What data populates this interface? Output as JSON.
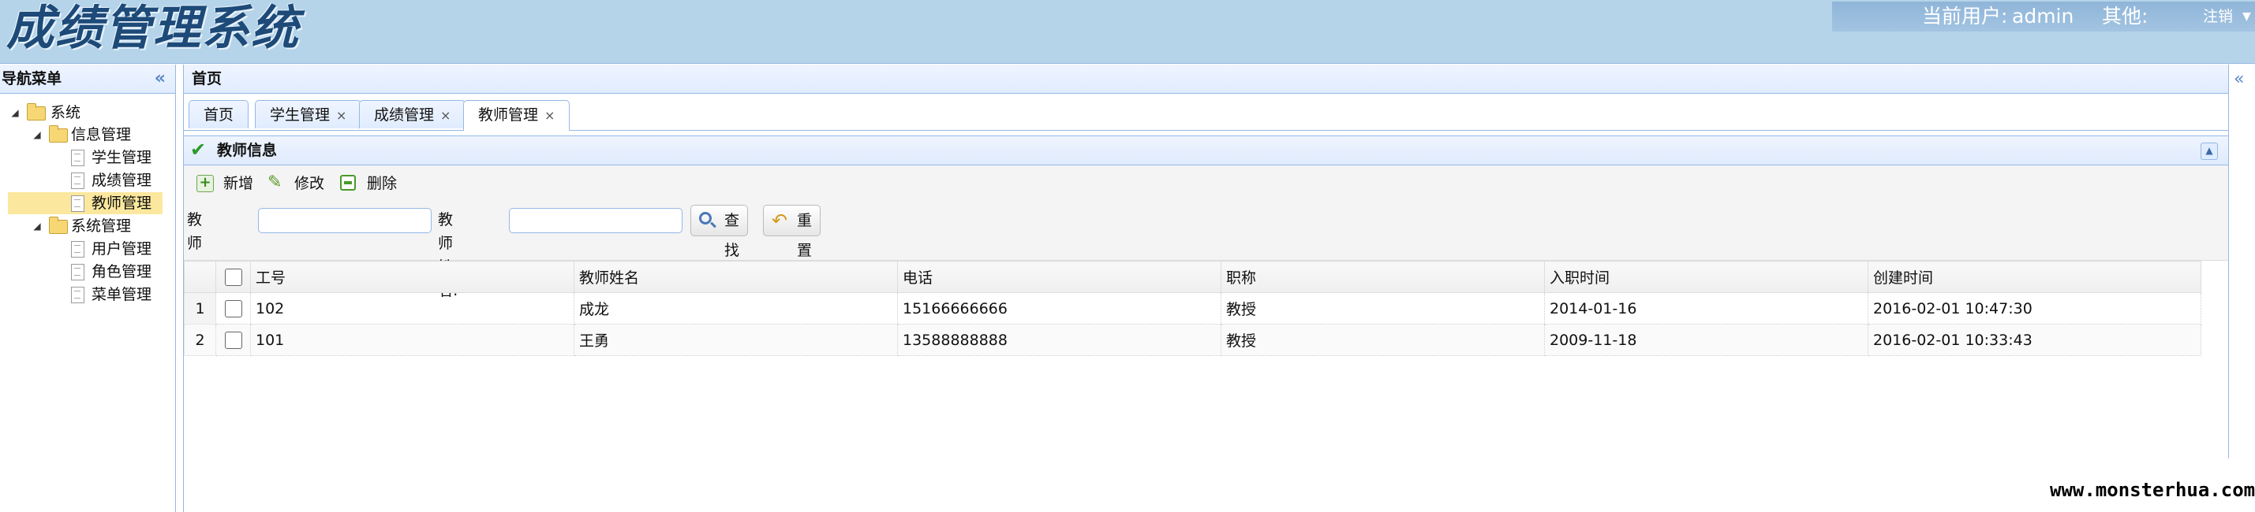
{
  "header": {
    "app_title": "成绩管理系统",
    "current_user_label": "当前用户:",
    "username": "admin",
    "other_label": "其他:",
    "logout_label": "注销"
  },
  "sidebar": {
    "title": "导航菜单",
    "tree": [
      {
        "label": "系统",
        "type": "folder",
        "level": 0
      },
      {
        "label": "信息管理",
        "type": "folder",
        "level": 1
      },
      {
        "label": "学生管理",
        "type": "file",
        "level": 2
      },
      {
        "label": "成绩管理",
        "type": "file",
        "level": 2
      },
      {
        "label": "教师管理",
        "type": "file",
        "level": 2,
        "selected": true
      },
      {
        "label": "系统管理",
        "type": "folder",
        "level": 1
      },
      {
        "label": "用户管理",
        "type": "file",
        "level": 2
      },
      {
        "label": "角色管理",
        "type": "file",
        "level": 2
      },
      {
        "label": "菜单管理",
        "type": "file",
        "level": 2
      }
    ]
  },
  "main": {
    "title": "首页",
    "tabs": [
      {
        "label": "首页",
        "closable": false
      },
      {
        "label": "学生管理",
        "closable": true
      },
      {
        "label": "成绩管理",
        "closable": true
      },
      {
        "label": "教师管理",
        "closable": true,
        "active": true
      }
    ],
    "close_glyph": "×",
    "panel_title": "教师信息",
    "toolbar": {
      "add_label": "新增",
      "edit_label": "修改",
      "delete_label": "删除"
    },
    "search": {
      "teacher_id_label": "教师工号:",
      "teacher_id_value": "",
      "teacher_name_label": "教师姓名:",
      "teacher_name_value": "",
      "search_button": "查找",
      "reset_button": "重置"
    },
    "table": {
      "columns": [
        "工号",
        "教师姓名",
        "电话",
        "职称",
        "入职时间",
        "创建时间"
      ],
      "rows": [
        {
          "rownum": "1",
          "cells": [
            "102",
            "成龙",
            "15166666666",
            "教授",
            "2014-01-16",
            "2016-02-01 10:47:30"
          ]
        },
        {
          "rownum": "2",
          "cells": [
            "101",
            "王勇",
            "13588888888",
            "教授",
            "2009-11-18",
            "2016-02-01 10:33:43"
          ]
        }
      ]
    }
  },
  "watermark": "www.monsterhua.com",
  "colors": {
    "header_bg": "#b5d4ea",
    "border": "#95b8e7",
    "selected_node": "#fbe89e"
  }
}
